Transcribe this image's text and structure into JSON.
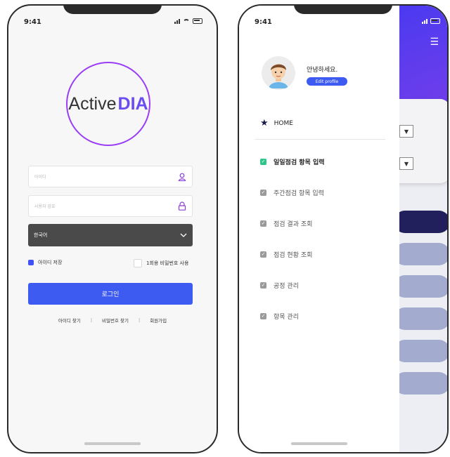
{
  "status": {
    "time": "9:41"
  },
  "login": {
    "logo_text": "Active",
    "logo_accent": "DIA",
    "id_placeholder": "아이디",
    "password_placeholder": "사용자 암호",
    "language_value": "한국어",
    "save_id_label": "아이디 저장",
    "otp_label": "1회용 비밀번호 사용",
    "login_button": "로그인",
    "links": [
      "아이디 찾기",
      "비밀번호 찾기",
      "회원가입"
    ],
    "separator": "|"
  },
  "drawer": {
    "greeting": "안녕하세요.",
    "edit_profile": "Edit profile",
    "home": "HOME",
    "items": [
      {
        "label": "일일점검 항목 입력",
        "active": true
      },
      {
        "label": "주간점검 항목 입력",
        "active": false
      },
      {
        "label": "점검 결과 조회",
        "active": false
      },
      {
        "label": "점검 현황 조회",
        "active": false
      },
      {
        "label": "공정 관리",
        "active": false
      },
      {
        "label": "항목 관리",
        "active": false
      }
    ]
  },
  "colors": {
    "accent": "#3d5af1",
    "logo_ring": "#9b3df5",
    "check_active": "#2ec48a",
    "header": "#5a3ef0"
  }
}
